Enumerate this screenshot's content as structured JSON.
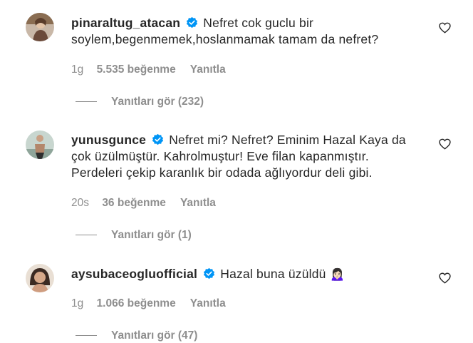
{
  "comments": [
    {
      "username": "pinaraltug_atacan",
      "text": "Nefret cok guclu bir soylem,begenmemek,hoslanmamak tamam da nefret?",
      "time": "1g",
      "likes": "5.535 beğenme",
      "reply_label": "Yanıtla",
      "view_replies": "Yanıtları gör (232)"
    },
    {
      "username": "yunusgunce",
      "text": "Nefret mi? Nefret? Eminim Hazal Kaya da çok üzülmüştür. Kahrolmuştur! Eve filan kapanmıştır. Perdeleri çekip karanlık bir odada ağlıyordur deli gibi.",
      "time": "20s",
      "likes": "36 beğenme",
      "reply_label": "Yanıtla",
      "view_replies": "Yanıtları gör (1)"
    },
    {
      "username": "aysubaceogluofficial",
      "text": "Hazal buna üzüldü 🙍🏻‍♀️",
      "time": "1g",
      "likes": "1.066 beğenme",
      "reply_label": "Yanıtla",
      "view_replies": "Yanıtları gör (47)"
    }
  ],
  "icons": {
    "verified": "verified-badge-icon",
    "like": "heart-outline-icon"
  },
  "colors": {
    "verified_blue": "#0095f6",
    "meta_gray": "#8e8e8e",
    "text": "#262626"
  }
}
